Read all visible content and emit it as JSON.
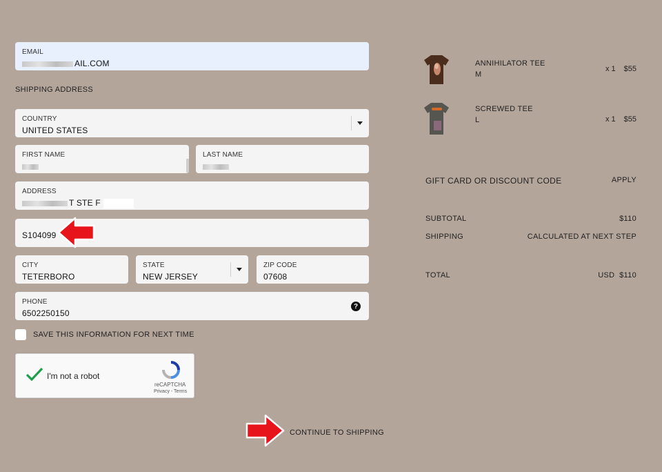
{
  "form": {
    "email": {
      "label": "EMAIL",
      "value": "AIL.COM"
    },
    "shipping_title": "SHIPPING ADDRESS",
    "country": {
      "label": "COUNTRY",
      "value": "UNITED STATES"
    },
    "first_name": {
      "label": "FIRST NAME",
      "value": ""
    },
    "last_name": {
      "label": "LAST NAME",
      "value": ""
    },
    "address": {
      "label": "ADDRESS",
      "value": "T STE F"
    },
    "address2": {
      "value": "S104099"
    },
    "city": {
      "label": "CITY",
      "value": "TETERBORO"
    },
    "state": {
      "label": "STATE",
      "value": "NEW JERSEY"
    },
    "zip": {
      "label": "ZIP CODE",
      "value": "07608"
    },
    "phone": {
      "label": "PHONE",
      "value": "6502250150"
    },
    "save_info": "SAVE THIS INFORMATION FOR NEXT TIME",
    "help_icon": "?",
    "recaptcha": {
      "text": "I'm not a robot",
      "brand": "reCAPTCHA",
      "links": "Privacy - Terms"
    },
    "continue": "CONTINUE TO SHIPPING"
  },
  "cart": {
    "items": [
      {
        "name": "ANNIHILATOR TEE",
        "size": "M",
        "qty": "x 1",
        "price": "$55"
      },
      {
        "name": "SCREWED TEE",
        "size": "L",
        "qty": "x 1",
        "price": "$55"
      }
    ],
    "discount_label": "GIFT CARD OR DISCOUNT CODE",
    "apply": "APPLY",
    "subtotal_label": "SUBTOTAL",
    "subtotal": "$110",
    "shipping_label": "SHIPPING",
    "shipping": "CALCULATED AT NEXT STEP",
    "total_label": "TOTAL",
    "currency": "USD",
    "total": "$110"
  },
  "colors": {
    "background": "#b4a59b",
    "arrow": "#e8141c",
    "check": "#1e9e4a"
  }
}
